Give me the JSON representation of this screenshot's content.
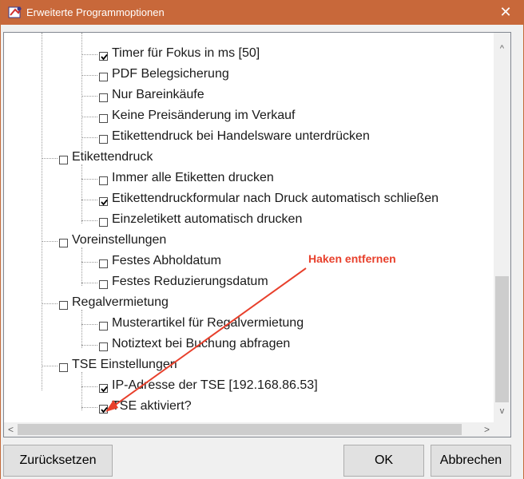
{
  "window": {
    "title": "Erweiterte Programmoptionen",
    "close_glyph": "✕",
    "accent_color": "#c8683a"
  },
  "tree": {
    "items": [
      {
        "label": "Timer für Fokus in ms [50]",
        "checked": true,
        "level": 2
      },
      {
        "label": "PDF Belegsicherung",
        "checked": false,
        "level": 2
      },
      {
        "label": "Nur Bareinkäufe",
        "checked": false,
        "level": 2
      },
      {
        "label": "Keine Preisänderung im Verkauf",
        "checked": false,
        "level": 2
      },
      {
        "label": "Etikettendruck bei Handelsware unterdrücken",
        "checked": false,
        "level": 2
      },
      {
        "label": "Etikettendruck",
        "checked": false,
        "level": 1
      },
      {
        "label": "Immer alle Etiketten drucken",
        "checked": false,
        "level": 2
      },
      {
        "label": "Etikettendruckformular nach Druck automatisch schließen",
        "checked": true,
        "level": 2
      },
      {
        "label": "Einzeletikett automatisch drucken",
        "checked": false,
        "level": 2
      },
      {
        "label": "Voreinstellungen",
        "checked": false,
        "level": 1
      },
      {
        "label": "Festes Abholdatum",
        "checked": false,
        "level": 2
      },
      {
        "label": "Festes Reduzierungsdatum",
        "checked": false,
        "level": 2
      },
      {
        "label": "Regalvermietung",
        "checked": false,
        "level": 1
      },
      {
        "label": "Musterartikel für Regalvermietung",
        "checked": false,
        "level": 2
      },
      {
        "label": "Notiztext bei Buchung abfragen",
        "checked": false,
        "level": 2
      },
      {
        "label": "TSE Einstellungen",
        "checked": false,
        "level": 1
      },
      {
        "label": "IP-Adresse der TSE [192.168.86.53]",
        "checked": true,
        "level": 2
      },
      {
        "label": "TSE aktiviert?",
        "checked": true,
        "level": 2
      }
    ]
  },
  "scrollbars": {
    "up_arrow": "^",
    "down_arrow": "v",
    "left_arrow": "<",
    "right_arrow": ">"
  },
  "annotation": {
    "text": "Haken entfernen",
    "color": "#e8402c"
  },
  "buttons": {
    "reset_label": "Zurücksetzen",
    "ok_label": "OK",
    "cancel_label": "Abbrechen"
  }
}
